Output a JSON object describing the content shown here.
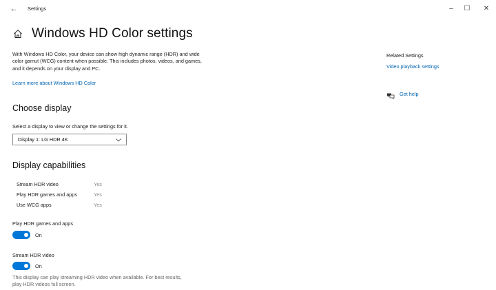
{
  "titlebar": {
    "back_glyph": "←",
    "title": "Settings",
    "minimize_glyph": "–",
    "maximize_glyph": "☐",
    "close_glyph": "✕"
  },
  "page": {
    "title": "Windows HD Color settings",
    "intro": "With Windows HD Color, your device can show high dynamic range (HDR) and wide color gamut (WCG) content when possible. This includes photos, videos, and games, and it depends on your display and PC.",
    "learn_more": "Learn more about Windows HD Color"
  },
  "choose_display": {
    "heading": "Choose display",
    "description": "Select a display to view or change the settings for it.",
    "selected": "Display 1: LG HDR 4K"
  },
  "capabilities": {
    "heading": "Display capabilities",
    "rows": [
      {
        "label": "Stream HDR video",
        "value": "Yes"
      },
      {
        "label": "Play HDR games and apps",
        "value": "Yes"
      },
      {
        "label": "Use WCG apps",
        "value": "Yes"
      }
    ]
  },
  "toggles": {
    "games": {
      "label": "Play HDR games and apps",
      "state": "On",
      "on": true
    },
    "stream": {
      "label": "Stream HDR video",
      "state": "On",
      "on": true,
      "description": "This display can play streaming HDR video when available. For best results, play HDR videos full screen."
    }
  },
  "related": {
    "heading": "Related Settings",
    "link": "Video playback settings",
    "help": "Get help"
  },
  "colors": {
    "accent": "#0078d7",
    "link": "#0063b1"
  },
  "icons": {
    "home": "home-icon",
    "back": "back-arrow-icon",
    "chevron": "chevron-down-icon",
    "help": "help-chat-icon"
  }
}
